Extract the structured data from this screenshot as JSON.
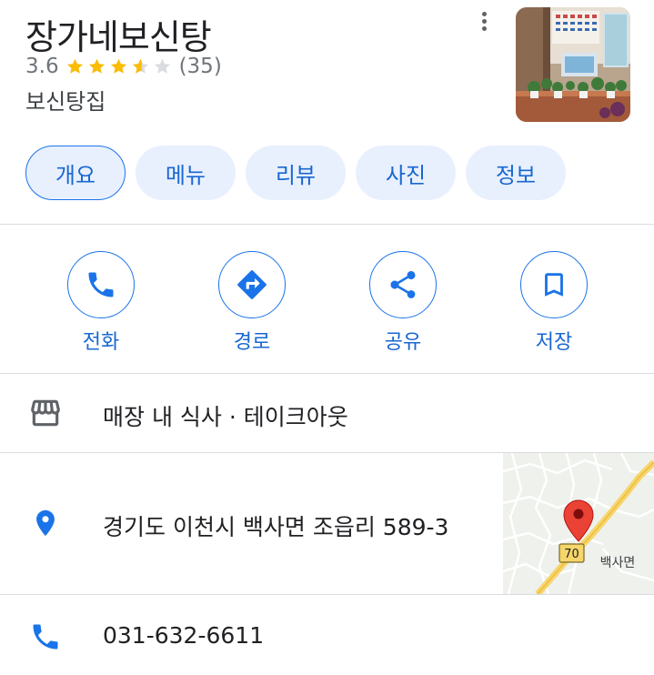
{
  "place": {
    "name": "장가네보신탕",
    "rating": "3.6",
    "rating_value": 3.6,
    "review_count": "(35)",
    "category": "보신탕집"
  },
  "tabs": [
    {
      "label": "개요",
      "active": true
    },
    {
      "label": "메뉴",
      "active": false
    },
    {
      "label": "리뷰",
      "active": false
    },
    {
      "label": "사진",
      "active": false
    },
    {
      "label": "정보",
      "active": false
    }
  ],
  "actions": [
    {
      "label": "전화",
      "icon": "phone-icon"
    },
    {
      "label": "경로",
      "icon": "directions-icon"
    },
    {
      "label": "공유",
      "icon": "share-icon"
    },
    {
      "label": "저장",
      "icon": "bookmark-icon"
    }
  ],
  "info": {
    "service_options": "매장 내 식사 · 테이크아웃",
    "address": "경기도 이천시 백사면 조읍리 589-3",
    "phone": "031-632-6611"
  },
  "map": {
    "route_number": "70",
    "area_label": "백사면"
  },
  "colors": {
    "accent": "#1a73e8",
    "accent_text": "#1967d2",
    "chip_bg": "#e8f0fe",
    "star": "#fbbc04",
    "pin": "#ea4335"
  }
}
